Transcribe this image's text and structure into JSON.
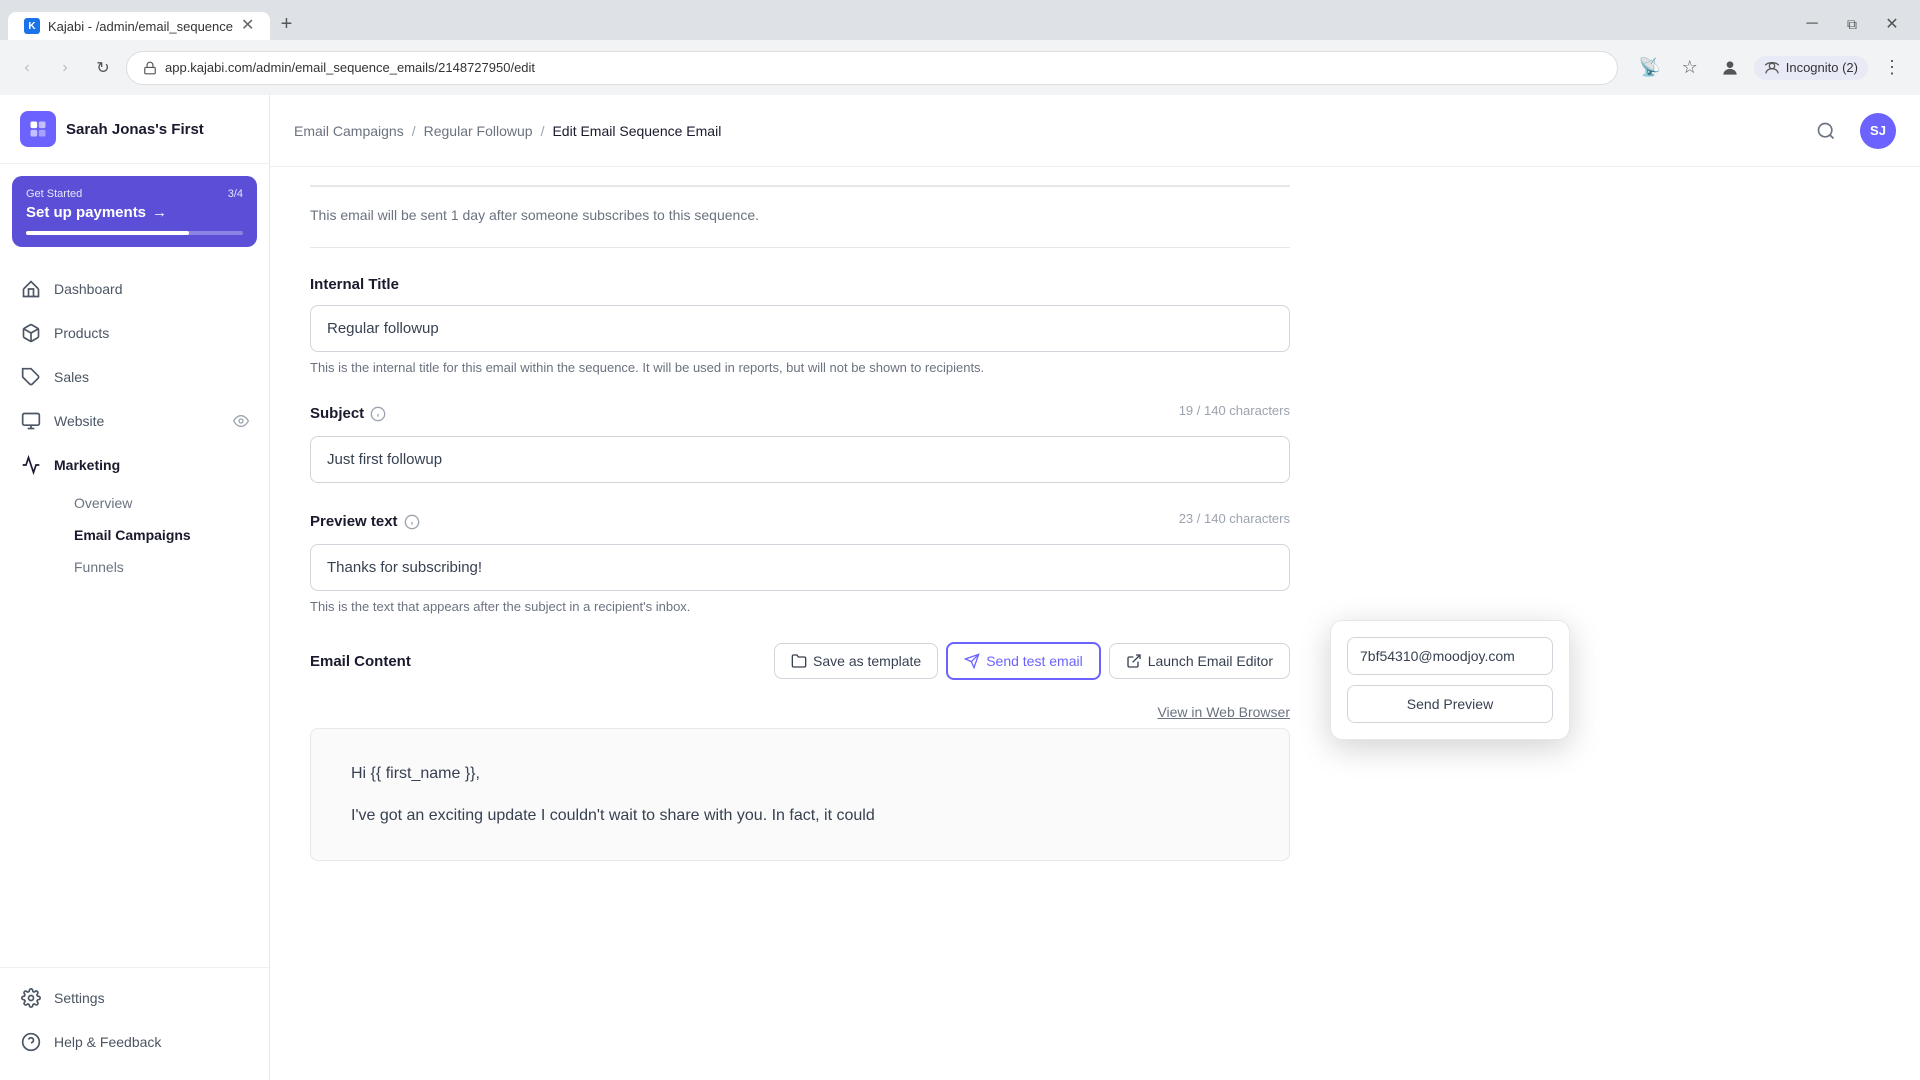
{
  "browser": {
    "tab_label": "Kajabi - /admin/email_sequence",
    "tab_favicon": "K",
    "address_bar": "app.kajabi.com/admin/email_sequence_emails/2148727950/edit",
    "incognito_label": "Incognito (2)"
  },
  "sidebar": {
    "logo_text": "K",
    "site_name": "Sarah Jonas's First",
    "get_started": {
      "label": "Get Started",
      "count": "3/4",
      "action": "Set up payments",
      "arrow": "→"
    },
    "nav_items": [
      {
        "id": "dashboard",
        "label": "Dashboard",
        "icon": "home"
      },
      {
        "id": "products",
        "label": "Products",
        "icon": "box"
      },
      {
        "id": "sales",
        "label": "Sales",
        "icon": "tag"
      },
      {
        "id": "website",
        "label": "Website",
        "icon": "monitor",
        "has_eye": true
      },
      {
        "id": "marketing",
        "label": "Marketing",
        "icon": "megaphone",
        "active": true
      }
    ],
    "marketing_sub": [
      {
        "id": "overview",
        "label": "Overview"
      },
      {
        "id": "email-campaigns",
        "label": "Email Campaigns",
        "active": true
      },
      {
        "id": "funnels",
        "label": "Funnels"
      }
    ],
    "bottom_items": [
      {
        "id": "settings",
        "label": "Settings",
        "icon": "gear"
      },
      {
        "id": "help",
        "label": "Help & Feedback",
        "icon": "question"
      }
    ]
  },
  "header": {
    "breadcrumb": [
      {
        "label": "Email Campaigns"
      },
      {
        "label": "Regular Followup"
      },
      {
        "label": "Edit Email Sequence Email",
        "current": true
      }
    ],
    "avatar_initials": "SJ"
  },
  "form": {
    "send_timing": "This email will be sent 1 day after someone subscribes to this sequence.",
    "internal_title": {
      "label": "Internal Title",
      "value": "Regular followup",
      "hint": "This is the internal title for this email within the sequence. It will be used in reports, but will not be shown to recipients."
    },
    "subject": {
      "label": "Subject",
      "char_count": "19 / 140 characters",
      "value": "Just first followup"
    },
    "preview_text": {
      "label": "Preview text",
      "char_count": "23 / 140 characters",
      "value": "Thanks for subscribing!",
      "hint": "This is the text that appears after the subject in a recipient's inbox."
    },
    "email_content": {
      "label": "Email Content",
      "save_template_btn": "Save as template",
      "send_test_btn": "Send test email",
      "launch_editor_btn": "Launch Email Editor",
      "view_in_browser_link": "View in Web Browser"
    },
    "email_body_line1": "Hi {{ first_name }},",
    "email_body_line2": "I've got an exciting update I couldn't wait to share with you. In fact, it could"
  },
  "popup": {
    "email_input_value": "7bf54310@moodjoy.com",
    "send_preview_btn": "Send Preview"
  }
}
